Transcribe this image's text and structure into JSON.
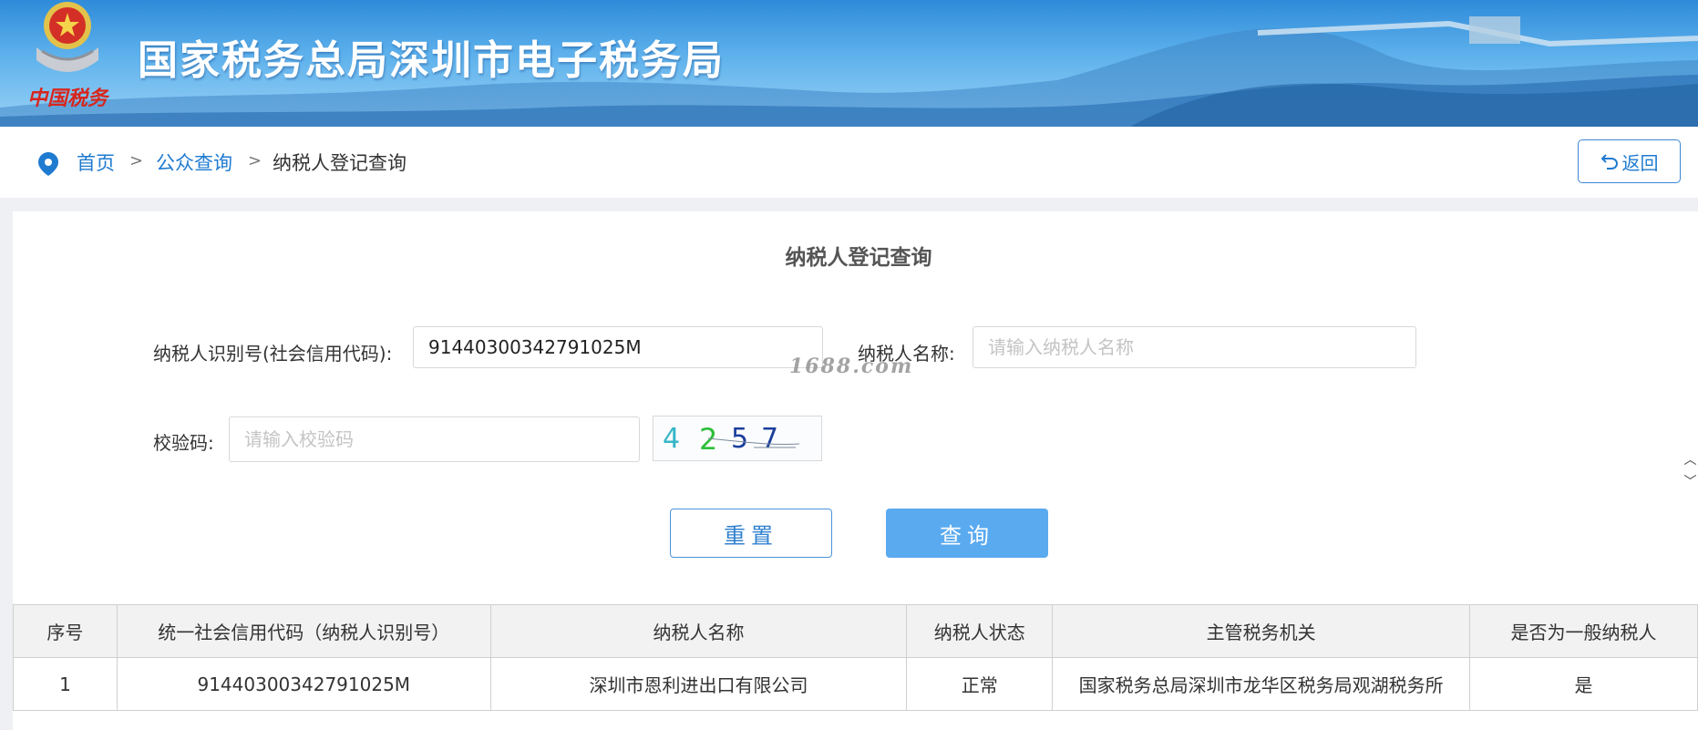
{
  "banner": {
    "title": "国家税务总局深圳市电子税务局",
    "emblem_text": "中国税务"
  },
  "breadcrumb": {
    "home": "首页",
    "sep1": ">",
    "public_query": "公众查询",
    "sep2": ">",
    "current": "纳税人登记查询"
  },
  "back_button": {
    "icon": "undo-arrow-icon",
    "label": "返回"
  },
  "form": {
    "title": "纳税人登记查询",
    "taxpayer_id_label": "纳税人识别号(社会信用代码):",
    "taxpayer_id_value": "91440300342791025M",
    "taxpayer_name_label": "纳税人名称:",
    "taxpayer_name_placeholder": "请输入纳税人名称",
    "verify_code_label": "校验码:",
    "verify_code_placeholder": "请输入校验码",
    "captcha_digits": [
      "4",
      "2",
      "5",
      "7"
    ],
    "captcha_colors": [
      "#35b6c6",
      "#2fbf3a",
      "#1b3f9c",
      "#1b3f9c"
    ],
    "reset_label": "重置",
    "query_label": "查询"
  },
  "watermark": "1688.com",
  "results": {
    "columns": [
      "序号",
      "统一社会信用代码（纳税人识别号）",
      "纳税人名称",
      "纳税人状态",
      "主管税务机关",
      "是否为一般纳税人"
    ],
    "rows": [
      [
        "1",
        "91440300342791025M",
        "深圳市恩利进出口有限公司",
        "正常",
        "国家税务总局深圳市龙华区税务局观湖税务所",
        "是"
      ]
    ]
  },
  "colors": {
    "accent": "#1f7bd0",
    "query_button": "#5aaaf0",
    "banner_top": "#2f8bd9"
  }
}
